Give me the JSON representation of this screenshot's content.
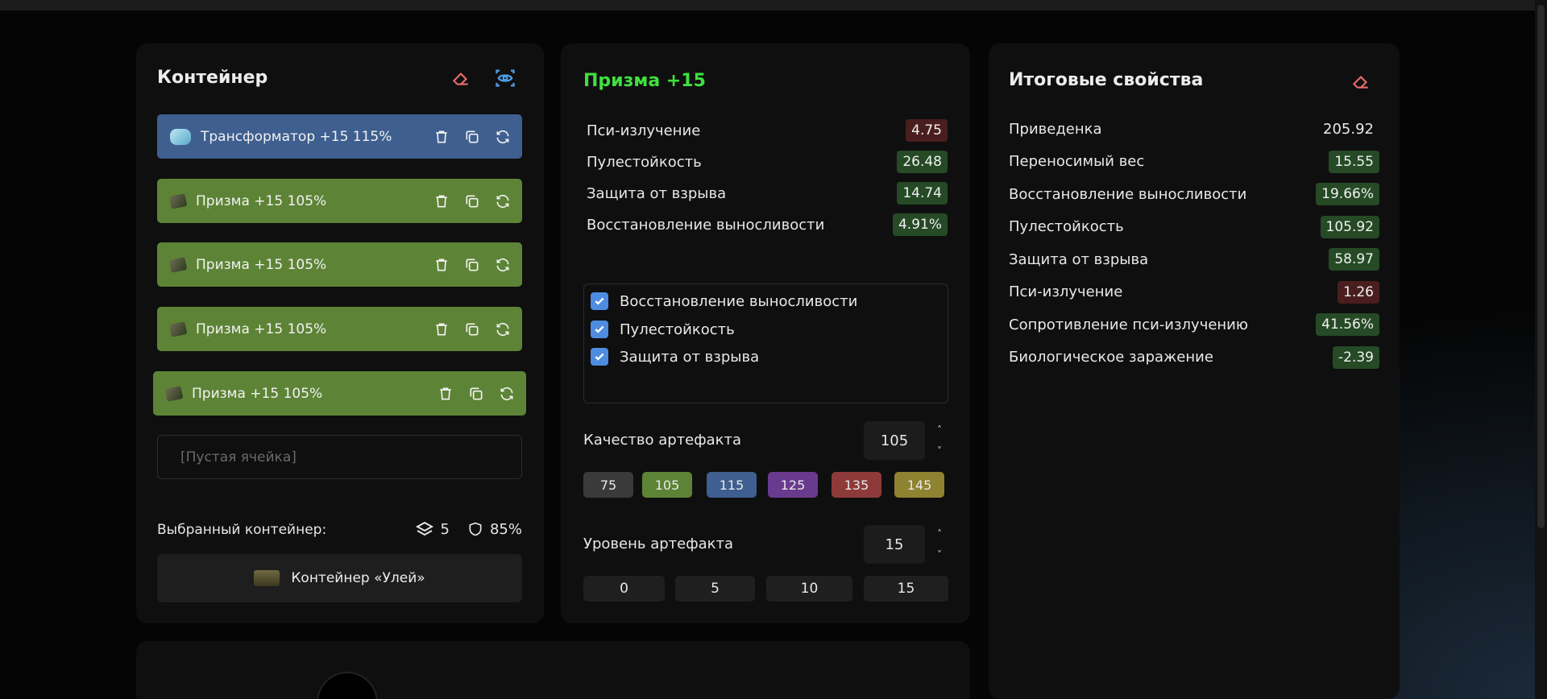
{
  "container_panel": {
    "title": "Контейнер",
    "items": [
      {
        "name": "Трансформатор +15 115%",
        "color": "blue"
      },
      {
        "name": "Призма +15 105%",
        "color": "green"
      },
      {
        "name": "Призма +15 105%",
        "color": "green"
      },
      {
        "name": "Призма +15 105%",
        "color": "green"
      },
      {
        "name": "Призма +15 105%",
        "color": "green"
      }
    ],
    "empty_cell": "[Пустая ячейка]",
    "selected_label": "Выбранный контейнер:",
    "slots": "5",
    "protection": "85%",
    "container_name": "Контейнер «Улей»"
  },
  "artifact_panel": {
    "title": "Призма +15",
    "stats": [
      {
        "name": "Пси-излучение",
        "value": "4.75",
        "tone": "negative"
      },
      {
        "name": "Пулестойкость",
        "value": "26.48",
        "tone": "positive"
      },
      {
        "name": "Защита от взрыва",
        "value": "14.74",
        "tone": "positive"
      },
      {
        "name": "Восстановление выносливости",
        "value": "4.91%",
        "tone": "positive"
      }
    ],
    "checkboxes": [
      {
        "label": "Восстановление выносливости",
        "checked": true
      },
      {
        "label": "Пулестойкость",
        "checked": true
      },
      {
        "label": "Защита от взрыва",
        "checked": true
      }
    ],
    "quality_label": "Качество артефакта",
    "quality_value": "105",
    "quality_presets": [
      {
        "label": "75",
        "color": "#3a3a3a"
      },
      {
        "label": "105",
        "color": "#5d8436"
      },
      {
        "label": "115",
        "color": "#3e5f8f"
      },
      {
        "label": "125",
        "color": "#6a3a8e"
      },
      {
        "label": "135",
        "color": "#8e3a3a"
      },
      {
        "label": "145",
        "color": "#8f8230"
      }
    ],
    "level_label": "Уровень артефакта",
    "level_value": "15",
    "level_presets": [
      "0",
      "5",
      "10",
      "15"
    ]
  },
  "summary_panel": {
    "title": "Итоговые свойства",
    "stats": [
      {
        "name": "Приведенка",
        "value": "205.92",
        "tone": "neutral"
      },
      {
        "name": "Переносимый вес",
        "value": "15.55",
        "tone": "positive"
      },
      {
        "name": "Восстановление выносливости",
        "value": "19.66%",
        "tone": "positive"
      },
      {
        "name": "Пулестойкость",
        "value": "105.92",
        "tone": "positive"
      },
      {
        "name": "Защита от взрыва",
        "value": "58.97",
        "tone": "positive"
      },
      {
        "name": "Пси-излучение",
        "value": "1.26",
        "tone": "negative"
      },
      {
        "name": "Сопротивление пси-излучению",
        "value": "41.56%",
        "tone": "positive"
      },
      {
        "name": "Биологическое заражение",
        "value": "-2.39",
        "tone": "positive"
      }
    ]
  },
  "colors": {
    "accent_green_title": "#3fe03f",
    "item_blue": "#3e5f8f",
    "item_green": "#5d8436",
    "badge_negative": "#4a1e1e",
    "badge_positive": "#254a25",
    "checkbox": "#4d8ce0",
    "eraser_icon": "#e46a6a",
    "eye_icon": "#4d9fe6"
  }
}
